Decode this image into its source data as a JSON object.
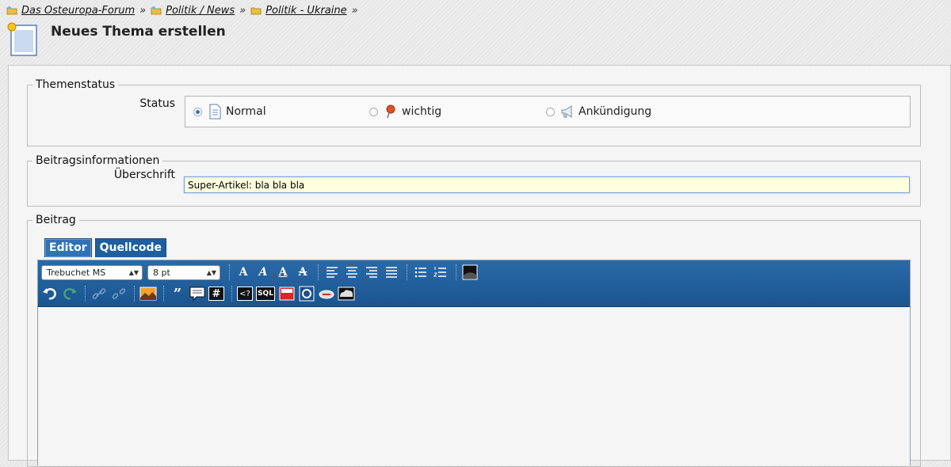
{
  "breadcrumb": {
    "items": [
      {
        "label": "Das Osteuropa-Forum"
      },
      {
        "label": "Politik / News"
      },
      {
        "label": "Politik - Ukraine"
      }
    ],
    "separator": "»"
  },
  "page_title": "Neues Thema erstellen",
  "themenstatus": {
    "legend": "Themenstatus",
    "label": "Status",
    "options": [
      {
        "label": "Normal",
        "selected": true
      },
      {
        "label": "wichtig",
        "selected": false
      },
      {
        "label": "Ankündigung",
        "selected": false
      }
    ]
  },
  "beitragsinfo": {
    "legend": "Beitragsinformationen",
    "label": "Überschrift",
    "value": "Super-Artikel: bla bla bla"
  },
  "beitrag": {
    "legend": "Beitrag",
    "tabs": [
      {
        "label": "Editor",
        "active": true
      },
      {
        "label": "Quellcode",
        "active": false
      }
    ],
    "font_select": "Trebuchet MS",
    "size_select": "8 pt",
    "sql_label": "SQL",
    "code_label": "<?"
  },
  "colors": {
    "toolbar": "#1d5fa0",
    "input_bg": "#ffffe0"
  }
}
